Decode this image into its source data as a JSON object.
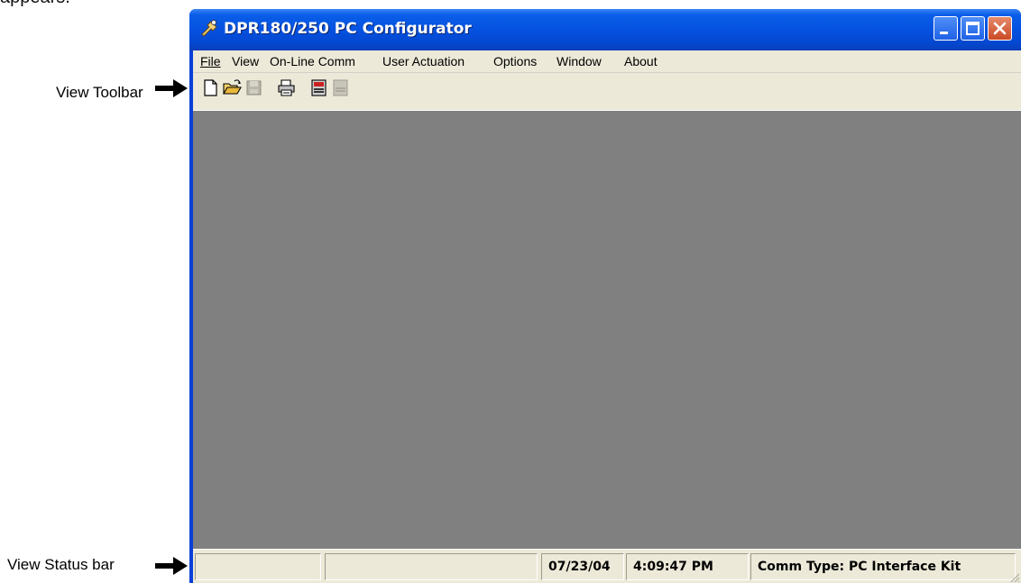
{
  "document": {
    "top_text": "appears.",
    "callout_toolbar": "View Toolbar",
    "callout_statusbar": "View Status bar"
  },
  "window": {
    "title": "DPR180/250 PC Configurator",
    "title_buttons": [
      "minimize-icon",
      "maximize-icon",
      "close-icon"
    ],
    "menu": [
      {
        "label": "File",
        "mnemonic": "F"
      },
      {
        "label": "View",
        "mnemonic": "V"
      },
      {
        "label": "On-Line Comm",
        "mnemonic": "C"
      },
      {
        "label": "User Actuation",
        "mnemonic": "U"
      },
      {
        "label": "Options",
        "mnemonic": "O"
      },
      {
        "label": "Window",
        "mnemonic": "W"
      },
      {
        "label": "About",
        "mnemonic": "A"
      }
    ],
    "toolbar": {
      "buttons": [
        {
          "icon": "new-document-icon",
          "enabled": true
        },
        {
          "icon": "open-folder-icon",
          "enabled": true
        },
        {
          "icon": "save-disk-icon",
          "enabled": false
        },
        {
          "icon": "printer-icon",
          "enabled": true
        },
        {
          "icon": "device-icon",
          "enabled": true
        },
        {
          "icon": "device-disabled-icon",
          "enabled": false
        }
      ]
    },
    "status": {
      "pane1": "",
      "pane2": "",
      "date": "07/23/04",
      "time": "4:09:47 PM",
      "comm": "Comm Type: PC Interface Kit"
    }
  },
  "colors": {
    "title_blue": "#0551e0",
    "frame_blue": "#0a3fd8",
    "chrome": "#ece9d8",
    "mdi_gray": "#808080",
    "close_red": "#cc4a25"
  }
}
